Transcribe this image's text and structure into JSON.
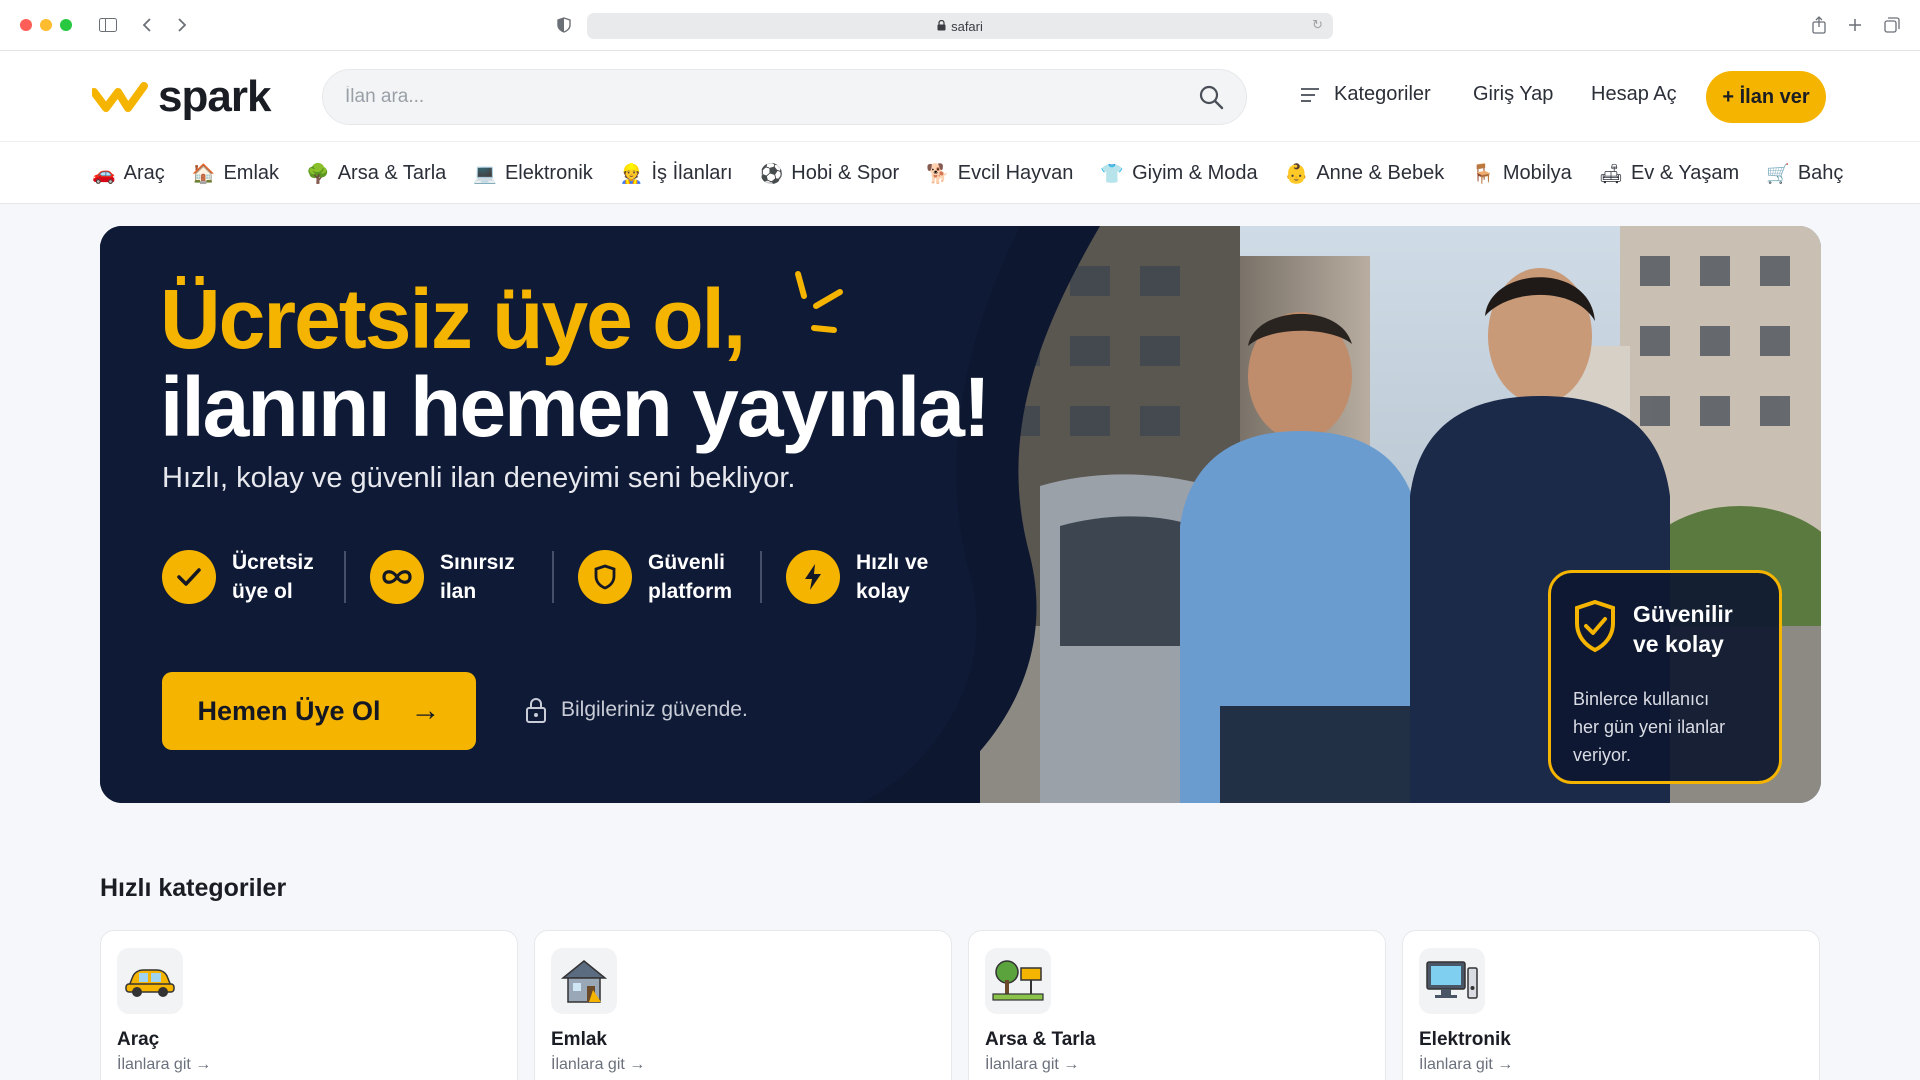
{
  "browser": {
    "url": "safari"
  },
  "header": {
    "logo_text": "spark",
    "search_placeholder": "İlan ara...",
    "nav": {
      "categories": "Kategoriler",
      "login": "Giriş Yap",
      "register": "Hesap Aç",
      "post_ad": "+ İlan ver"
    }
  },
  "category_strip": [
    {
      "label": "Araç",
      "icon": "🚗"
    },
    {
      "label": "Emlak",
      "icon": "🏠"
    },
    {
      "label": "Arsa & Tarla",
      "icon": "🌳"
    },
    {
      "label": "Elektronik",
      "icon": "💻"
    },
    {
      "label": "İş İlanları",
      "icon": "👷"
    },
    {
      "label": "Hobi & Spor",
      "icon": "⚽"
    },
    {
      "label": "Evcil Hayvan",
      "icon": "🐕"
    },
    {
      "label": "Giyim & Moda",
      "icon": "👕"
    },
    {
      "label": "Anne & Bebek",
      "icon": "👶"
    },
    {
      "label": "Mobilya",
      "icon": "🪑"
    },
    {
      "label": "Ev & Yaşam",
      "icon": "🛋"
    },
    {
      "label": "Bahç",
      "icon": "🛒"
    }
  ],
  "hero": {
    "title_line1": "Ücretsiz üye ol,",
    "title_line2": "ilanını hemen yayınla!",
    "subtitle": "Hızlı, kolay ve güvenli ilan deneyimi seni bekliyor.",
    "features": [
      {
        "line1": "Ücretsiz",
        "line2": "üye ol",
        "icon": "check-icon"
      },
      {
        "line1": "Sınırsız",
        "line2": "ilan",
        "icon": "infinity-icon"
      },
      {
        "line1": "Güvenli",
        "line2": "platform",
        "icon": "shield-icon"
      },
      {
        "line1": "Hızlı ve",
        "line2": "kolay",
        "icon": "lightning-icon"
      }
    ],
    "cta_label": "Hemen Üye Ol",
    "cta_arrow": "→",
    "secure_note": "Bilgileriniz güvende.",
    "trust_card": {
      "title_line1": "Güvenilir",
      "title_line2": "ve kolay",
      "body_line1": "Binlerce kullanıcı",
      "body_line2": "her gün yeni ilanlar",
      "body_line3": "veriyor."
    },
    "colors": {
      "accent": "#f5b400",
      "dark": "#0e1730"
    }
  },
  "quick_categories": {
    "title": "Hızlı kategoriler",
    "items": [
      {
        "name": "Araç",
        "link": "İlanlara git →",
        "icon": "car-icon"
      },
      {
        "name": "Emlak",
        "link": "İlanlara git →",
        "icon": "house-icon"
      },
      {
        "name": "Arsa & Tarla",
        "link": "İlanlara git →",
        "icon": "land-icon"
      },
      {
        "name": "Elektronik",
        "link": "İlanlara git →",
        "icon": "computer-icon"
      }
    ]
  }
}
